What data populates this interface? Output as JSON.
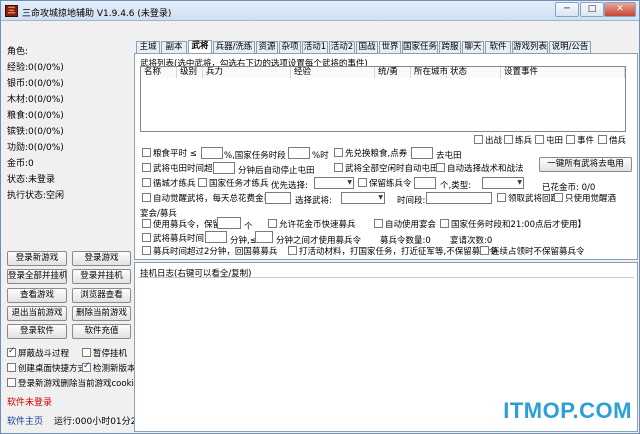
{
  "window": {
    "title": "三命攻城掠地辅助 V1.9.4.6 (未登录)",
    "icon": "三",
    "minimize": "─",
    "maximize": "□",
    "close": "✕"
  },
  "stats": [
    "角色:",
    "经验:0(0/0%)",
    "银币:0(0/0%)",
    "木材:0(0/0%)",
    "粮食:0(0/0%)",
    "镔铁:0(0/0%)",
    "功勋:0(0/0%)",
    "金币:0",
    "状态:未登录",
    "执行状态:空闲"
  ],
  "buttons": {
    "login_new": "登录新游戏",
    "login_game": "登录游戏",
    "login_all_hang": "登录全部并挂机",
    "login_hang": "登录并挂机",
    "view_game": "查看游戏",
    "browser_view": "浏览器查看",
    "exit_current": "退出当前游戏",
    "delete_current": "删除当前游戏",
    "login_software": "登录软件",
    "software_recharge": "软件充值",
    "one_click_tech": "一键所有武将去电用"
  },
  "left_checks": [
    {
      "label": "屏蔽战斗过程",
      "checked": true
    },
    {
      "label": "暂停挂机",
      "checked": false
    },
    {
      "label": "创建桌面快捷方式",
      "checked": false
    },
    {
      "label": "检测新版本",
      "checked": true
    },
    {
      "label": "登录新游戏删除当前游戏cookies",
      "checked": false
    }
  ],
  "left_footer": {
    "not_logged": "软件未登录",
    "home": "软件主页",
    "runtime": "运行:000小时01分28秒"
  },
  "tabs": [
    "主城",
    "副本",
    "武将",
    "兵器/洗练",
    "资源",
    "杂项",
    "活动1",
    "活动2",
    "国战",
    "世界",
    "国家任务",
    "跨服",
    "聊天",
    "软件",
    "游戏列表",
    "说明/公告"
  ],
  "generals": {
    "list_title": "武将列表(选中武将，勾选右下边的选项设置每个武将的事件)",
    "columns": [
      "名称",
      "级别",
      "兵力",
      "经验",
      "统/勇",
      "所在城市",
      "状态",
      "设置事件"
    ],
    "row_checks": [
      "出战",
      "练兵",
      "屯田",
      "事件",
      "借兵"
    ],
    "opt1": {
      "a": "粮食平时 ≤",
      "b": "%,国家任务时段 ≤",
      "c": "%时",
      "d": "先兑换粮食,点券 ≤",
      "e": "去屯田"
    },
    "opt2": {
      "a": "武将屯田时间超过",
      "b": "分钟后自动停止屯田",
      "c": "武将全部空闲时自动屯田",
      "d": "自动选择战术和战法"
    },
    "opt3": {
      "a": "循城才练兵",
      "b": "国家任务才练兵",
      "c": "优先选择:",
      "d": "保留练兵令",
      "e": "个,类型:",
      "f": "已花金币: 0/0"
    },
    "opt4": {
      "a": "自动觉醒武将，每天总花费金币 ≤",
      "b": "选择武将:",
      "c": "时间段:",
      "d": "领取武将回路",
      "e": "只使用觉醒酒"
    }
  },
  "banquet": {
    "title": "宴会/募兵",
    "b1": {
      "a": "使用募兵令，保留",
      "b": "个",
      "c": "允许花金币快速募兵",
      "d": "自动使用宴会【",
      "e": "国家任务时段和21:00点后才使用】"
    },
    "b2": {
      "a": "武将募兵时间 ≥",
      "b": "分钟,≤",
      "c": "分钟之间才使用募兵令",
      "d": "募兵令数量:0",
      "e": "宴请次数:0"
    },
    "b3": {
      "a": "募兵时间超过2分钟，回国募募兵",
      "b": "打活动材料，打国家任务，打近征军等,不保留募兵令",
      "c": "连续占领时不保留募兵令"
    }
  },
  "log": {
    "title": "挂机日志(右键可以看全/复制)"
  },
  "watermark": "ITMOP.COM"
}
